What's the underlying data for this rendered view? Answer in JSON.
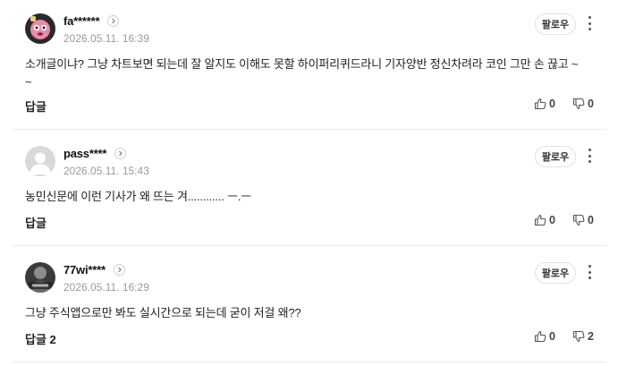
{
  "comments": [
    {
      "nickname": "fa******",
      "date": "2026.05.11. 16:39",
      "follow_label": "팔로우",
      "content": "소개글이냐? 그냥 차트보면 되는데 잘 알지도 이해도 못할 하이퍼리퀴드라니 기자양반 정신차려라 코인 그만 손 끊고 ~\n~",
      "reply_label": "답글",
      "likes": "0",
      "dislikes": "0",
      "avatar": "pink-character-avatar"
    },
    {
      "nickname": "pass****",
      "date": "2026.05.11. 15:43",
      "follow_label": "팔로우",
      "content": "농민신문에 이런 기사가 왜 뜨는 겨............ ㅡ.ㅡ",
      "reply_label": "답글",
      "likes": "0",
      "dislikes": "0",
      "avatar": "default-user-avatar"
    },
    {
      "nickname": "77wi****",
      "date": "2026.05.11. 16:29",
      "follow_label": "팔로우",
      "content": "그냥 주식앱으로만 봐도 실시간으로 되는데 굳이 저걸 왜??",
      "reply_label": "답글 2",
      "likes": "0",
      "dislikes": "2",
      "avatar": "photo-avatar"
    }
  ],
  "colors": {
    "divider": "#ececec",
    "date": "#9a9a9a",
    "text": "#222222"
  }
}
